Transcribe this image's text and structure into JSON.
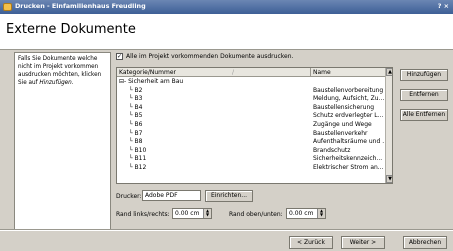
{
  "window": {
    "title": "Drucken - Einfamilienhaus Freudling",
    "controls": "? ×"
  },
  "header": {
    "title": "Externe Dokumente"
  },
  "left_panel": {
    "text_lines": [
      "Falls Sie Dokumente welche",
      "nicht im Projekt vorkommen",
      "ausdrucken möchten, klicken",
      "Sie auf "
    ],
    "emph": "Hinzufügen."
  },
  "checkbox": {
    "checked": true,
    "mark": "✓",
    "label": "Alle im Projekt vorkommenden Dokumente ausdrucken."
  },
  "table": {
    "columns": [
      "Kategorie/Nummer",
      "Name"
    ],
    "sort_glyph": "/",
    "rows": [
      {
        "num": "⊟- Sicherheit am Bau",
        "name": ""
      },
      {
        "num": "B2",
        "name": "Baustellenvorbereitung"
      },
      {
        "num": "B3",
        "name": "Meldung, Aufsicht, Zu..."
      },
      {
        "num": "B4",
        "name": "Baustellensicherung"
      },
      {
        "num": "B5",
        "name": "Schutz erdverlegter L..."
      },
      {
        "num": "B6",
        "name": "Zugänge und Wege"
      },
      {
        "num": "B7",
        "name": "Baustellenverkehr"
      },
      {
        "num": "B8",
        "name": "Aufenthaltsräume und ..."
      },
      {
        "num": "B10",
        "name": "Brandschutz"
      },
      {
        "num": "B11",
        "name": "Sicherheitskennzeich..."
      },
      {
        "num": "B12",
        "name": "Elektrischer Strom an..."
      }
    ]
  },
  "drucker": {
    "label": "Drucker:",
    "value": "Adobe PDF",
    "button": "Einrichten..."
  },
  "rand": {
    "lr_label": "Rand links/rechts:",
    "lr_value": "0.00 cm",
    "ou_label": "Rand oben/unten:",
    "ou_value": "0.00 cm"
  },
  "right_buttons": {
    "add": "Hinzufügen",
    "remove": "Entfernen",
    "remove_all": "Alle Entfernen"
  },
  "footer": {
    "back": "< Zurück",
    "next": "Weiter >",
    "cancel": "Abbrechen"
  }
}
